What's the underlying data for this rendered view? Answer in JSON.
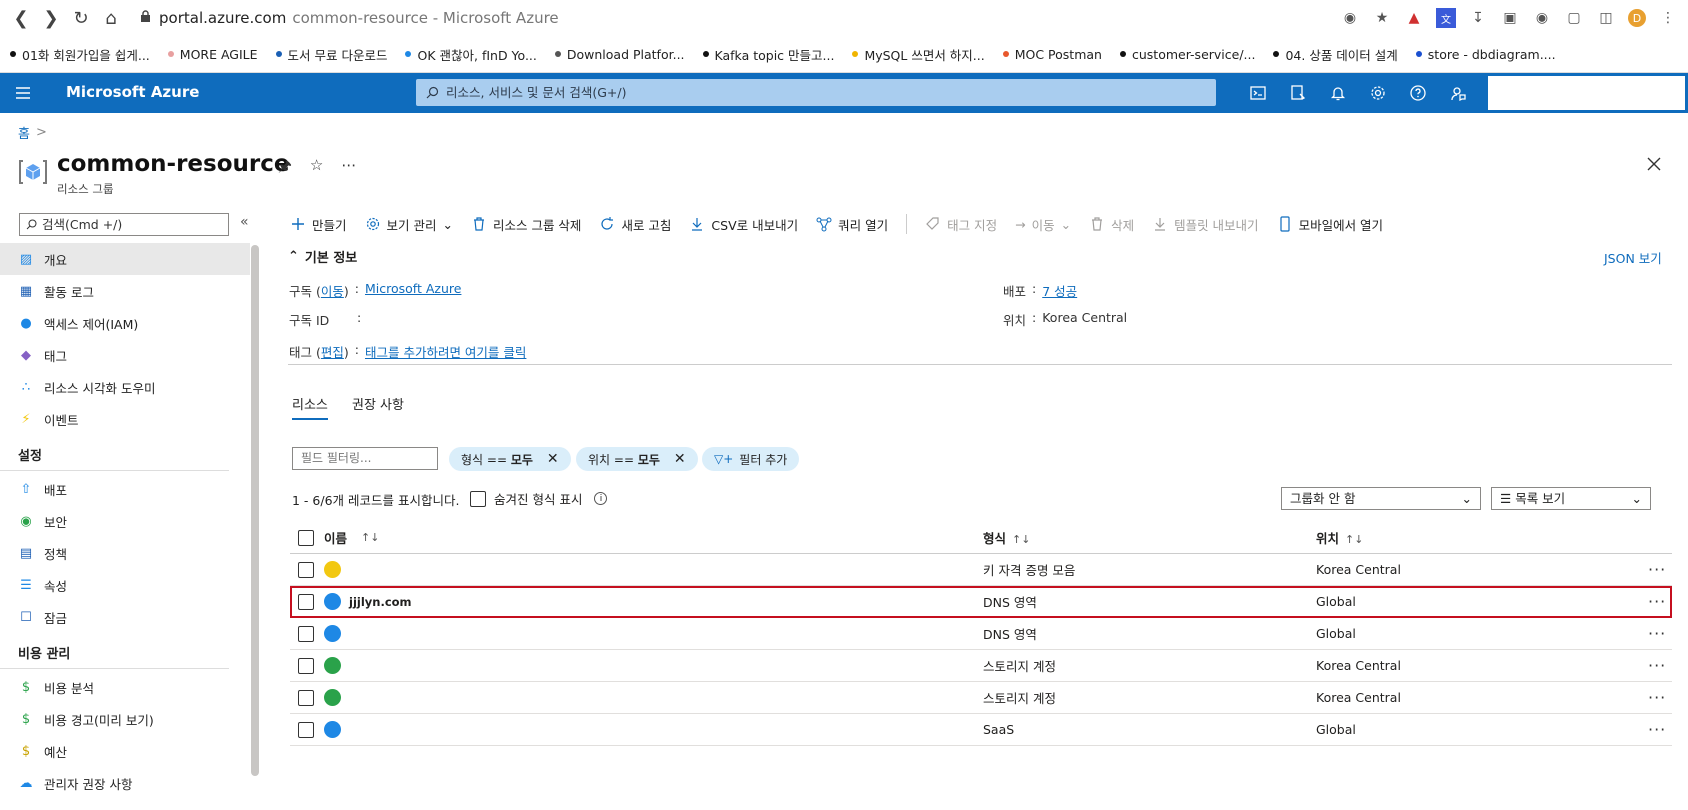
{
  "browser": {
    "url_host": "portal.azure.com",
    "url_rest": "common-resource - Microsoft Azure",
    "avatar_letter": "D",
    "bookmarks": [
      {
        "label": "01화 회원가입을 쉽게...",
        "color": "#111111"
      },
      {
        "label": "MORE AGILE",
        "color": "#e8a0a0"
      },
      {
        "label": "도서 무료 다운로드",
        "color": "#1a5fb4"
      },
      {
        "label": "OK 괜찮아, fInD Yo...",
        "color": "#1e88e5"
      },
      {
        "label": "Download Platfor...",
        "color": "#555555"
      },
      {
        "label": "Kafka topic 만들고...",
        "color": "#111111"
      },
      {
        "label": "MySQL 쓰면서 하지...",
        "color": "#f0b400"
      },
      {
        "label": "MOC Postman",
        "color": "#e8582d"
      },
      {
        "label": "customer-service/...",
        "color": "#111111"
      },
      {
        "label": "04. 상품 데이터 설계",
        "color": "#111111"
      },
      {
        "label": "store - dbdiagram....",
        "color": "#1a4fd0"
      }
    ]
  },
  "azure": {
    "title": "Microsoft Azure",
    "search_placeholder": "리소스, 서비스 및 문서 검색(G+/)"
  },
  "breadcrumb": {
    "home": "홈",
    "sep": ">"
  },
  "resource": {
    "title": "common-resource",
    "subtitle": "리소스 그룹"
  },
  "sidebar": {
    "search_placeholder": "검색(Cmd +/)",
    "items": [
      {
        "label": "개요",
        "icon": "overview-icon",
        "active": true
      },
      {
        "label": "활동 로그",
        "icon": "log-icon"
      },
      {
        "label": "액세스 제어(IAM)",
        "icon": "iam-icon"
      },
      {
        "label": "태그",
        "icon": "tag-icon"
      },
      {
        "label": "리소스 시각화 도우미",
        "icon": "visualizer-icon"
      },
      {
        "label": "이벤트",
        "icon": "event-icon"
      }
    ],
    "section_settings": "설정",
    "settings_items": [
      {
        "label": "배포",
        "icon": "deploy-icon"
      },
      {
        "label": "보안",
        "icon": "security-icon"
      },
      {
        "label": "정책",
        "icon": "policy-icon"
      },
      {
        "label": "속성",
        "icon": "properties-icon"
      },
      {
        "label": "잠금",
        "icon": "lock-icon"
      }
    ],
    "section_cost": "비용 관리",
    "cost_items": [
      {
        "label": "비용 분석",
        "icon": "cost-analysis-icon"
      },
      {
        "label": "비용 경고(미리 보기)",
        "icon": "cost-alert-icon"
      },
      {
        "label": "예산",
        "icon": "budget-icon"
      },
      {
        "label": "관리자 권장 사항",
        "icon": "advisor-icon"
      }
    ]
  },
  "toolbar": {
    "create": "만들기",
    "manage_view": "보기 관리",
    "delete_group": "리소스 그룹 삭제",
    "refresh": "새로 고침",
    "export_csv": "CSV로 내보내기",
    "open_query": "쿼리 열기",
    "assign_tags": "태그 지정",
    "move": "이동",
    "delete": "삭제",
    "export_template": "템플릿 내보내기",
    "open_mobile": "모바일에서 열기"
  },
  "essentials": {
    "header": "기본 정보",
    "json_view": "JSON 보기",
    "subscription_label": "구독 (",
    "subscription_move": "이동",
    "subscription_close": ")",
    "colon": ":",
    "subscription_value": "Microsoft Azure",
    "subscription_id_label": "구독 ID",
    "deploy_label": "배포",
    "deploy_value": "7 성공",
    "location_label": "위치",
    "location_value": "Korea Central",
    "tags_label": "태그 (",
    "tags_edit": "편집",
    "tags_close": ")",
    "tags_value": "태그를 추가하려면 여기를 클릭"
  },
  "tabs": {
    "resources": "리소스",
    "recommendations": "권장 사항"
  },
  "filters": {
    "field_placeholder": "필드 필터링...",
    "type_pill_label": "형식 == ",
    "type_pill_value": "모두",
    "loc_pill_label": "위치 == ",
    "loc_pill_value": "모두",
    "add_filter": "필터 추가"
  },
  "list": {
    "count_text": "1 - 6/6개 레코드를 표시합니다.",
    "show_hidden": "숨겨진 형식 표시",
    "group_by": "그룹화 안 함",
    "view_mode": "목록 보기",
    "col_name": "이름",
    "col_type": "형식",
    "col_location": "위치",
    "rows": [
      {
        "name": "",
        "type": "키 자격 증명 모음",
        "location": "Korea Central",
        "icon": "key-vault-icon",
        "color": "#f2c811"
      },
      {
        "name": "jjjlyn.com",
        "type": "DNS 영역",
        "location": "Global",
        "icon": "dns-zone-icon",
        "color": "#1e88e5",
        "selected": true
      },
      {
        "name": "",
        "type": "DNS 영역",
        "location": "Global",
        "icon": "dns-zone-icon",
        "color": "#1e88e5"
      },
      {
        "name": "",
        "type": "스토리지 계정",
        "location": "Korea Central",
        "icon": "storage-icon",
        "color": "#2aa24a"
      },
      {
        "name": "",
        "type": "스토리지 계정",
        "location": "Korea Central",
        "icon": "storage-icon",
        "color": "#2aa24a"
      },
      {
        "name": "",
        "type": "SaaS",
        "location": "Global",
        "icon": "saas-icon",
        "color": "#1e88e5"
      }
    ]
  }
}
